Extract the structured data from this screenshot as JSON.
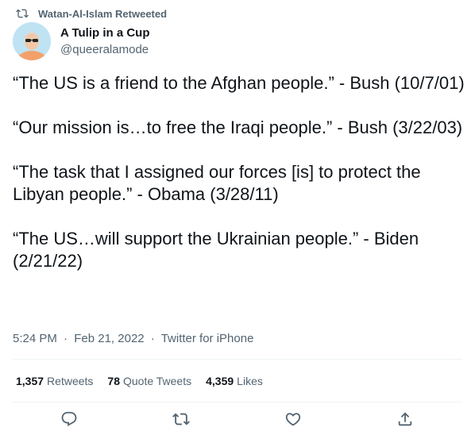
{
  "context": {
    "retweeted_by": "Watan-Al-Islam Retweeted",
    "icon": "retweet-icon"
  },
  "author": {
    "display_name": "A Tulip in a Cup",
    "handle": "@queeralamode",
    "avatar_icon": "avatar"
  },
  "tweet": {
    "paragraphs": [
      "“The US is a friend to the Afghan people.” - Bush (10/7/01)",
      "“Our mission is…to free the Iraqi people.” - Bush (3/22/03)",
      "“The task that I assigned our forces [is] to protect the Libyan people.” - Obama (3/28/11)",
      "“The US…will support the Ukrainian people.” - Biden (2/21/22)"
    ]
  },
  "meta": {
    "time": "5:24 PM",
    "date": "Feb 21, 2022",
    "source": "Twitter for iPhone",
    "separator": "·"
  },
  "stats": {
    "retweets_count": "1,357",
    "retweets_label": "Retweets",
    "quote_count": "78",
    "quote_label": "Quote Tweets",
    "likes_count": "4,359",
    "likes_label": "Likes"
  },
  "actions": {
    "reply_icon": "reply-icon",
    "retweet_icon": "retweet-icon",
    "like_icon": "heart-icon",
    "share_icon": "share-icon"
  },
  "colors": {
    "text_primary": "#0f1419",
    "text_secondary": "#536471",
    "divider": "#eff3f4",
    "avatar_bg": "#b8e0f2"
  }
}
